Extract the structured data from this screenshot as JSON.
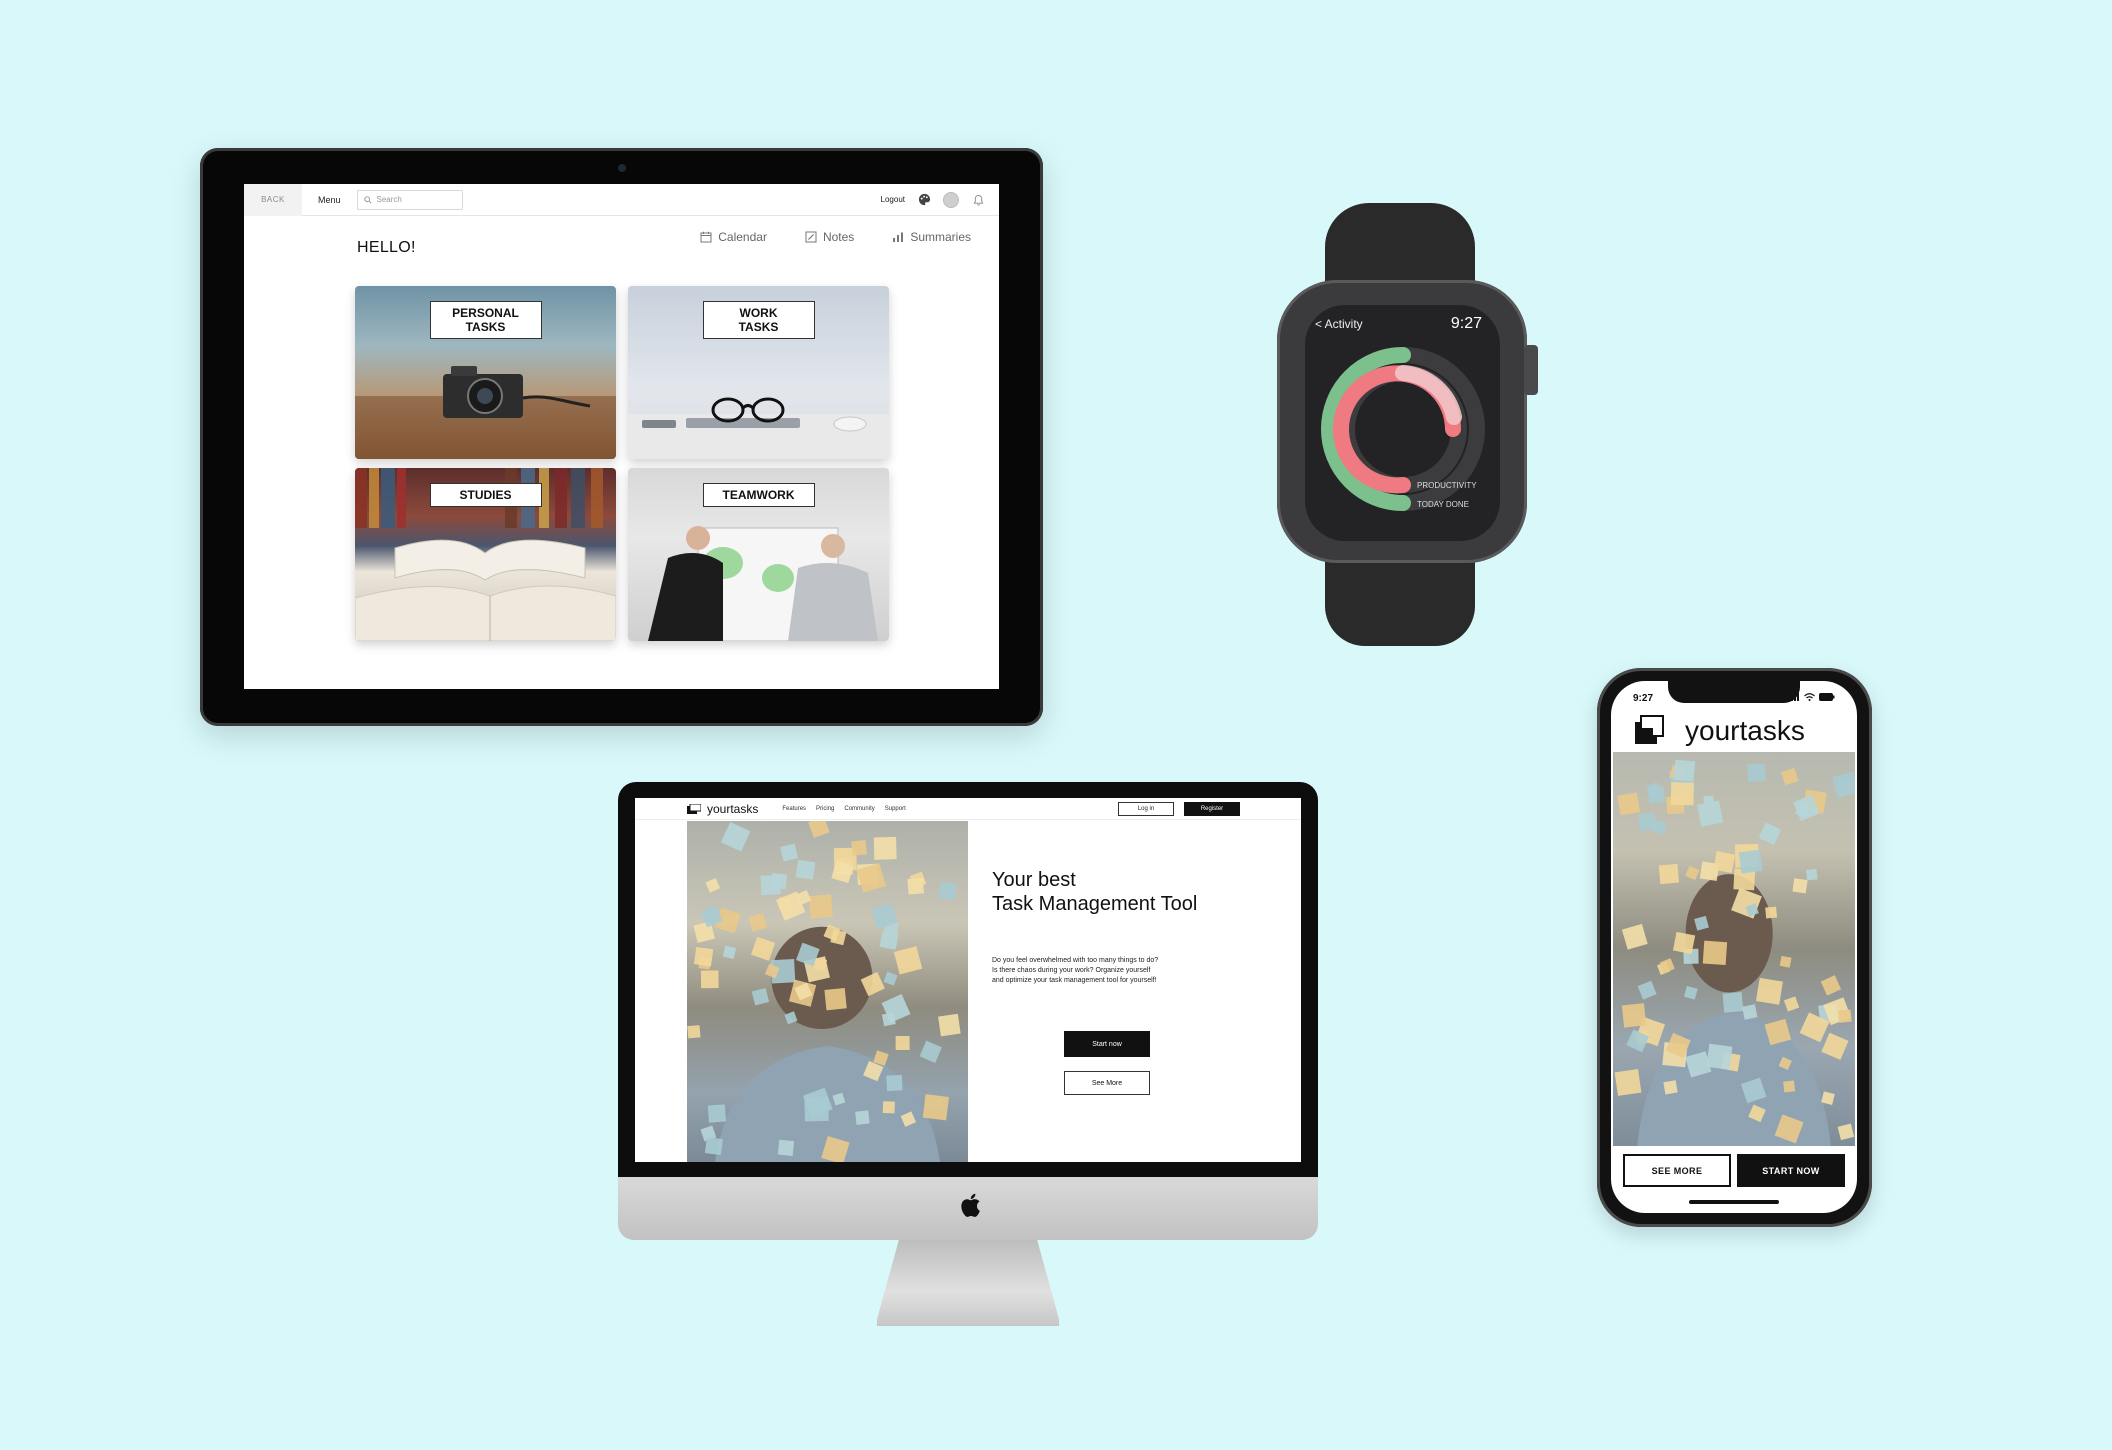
{
  "tablet": {
    "topbar": {
      "back_label": "BACK",
      "menu_label": "Menu",
      "search_placeholder": "Search",
      "logout_label": "Logout"
    },
    "greeting": "HELLO!",
    "nav": [
      {
        "label": "Calendar",
        "icon": "calendar-icon"
      },
      {
        "label": "Notes",
        "icon": "notes-icon"
      },
      {
        "label": "Summaries",
        "icon": "chart-icon"
      }
    ],
    "tiles": [
      {
        "line1": "PERSONAL",
        "line2": "TASKS"
      },
      {
        "line1": "WORK",
        "line2": "TASKS"
      },
      {
        "line1": "STUDIES"
      },
      {
        "line1": "TEAMWORK"
      }
    ]
  },
  "watch": {
    "back_label": "< Activity",
    "time": "9:27",
    "legend": {
      "productivity": "PRODUCTIVITY",
      "today_done": "TODAY DONE"
    },
    "colors": {
      "productivity": "#f07a82",
      "today_done": "#7cc08d"
    }
  },
  "imac": {
    "logo": "yourtasks",
    "links": [
      "Features",
      "Pricing",
      "Community",
      "Support"
    ],
    "login_label": "Log in",
    "register_label": "Register",
    "title_line1": "Your best",
    "title_line2": "Task Management Tool",
    "desc_line1": "Do you feel overwhelmed with too many things to do?",
    "desc_line2": "Is there chaos during your work? Organize yourself",
    "desc_line3": "and optimize your task management tool for yourself!",
    "start_label": "Start now",
    "more_label": "See More"
  },
  "phone": {
    "time": "9:27",
    "brand": "yourtasks",
    "see_more_label": "SEE MORE",
    "start_now_label": "START NOW"
  }
}
